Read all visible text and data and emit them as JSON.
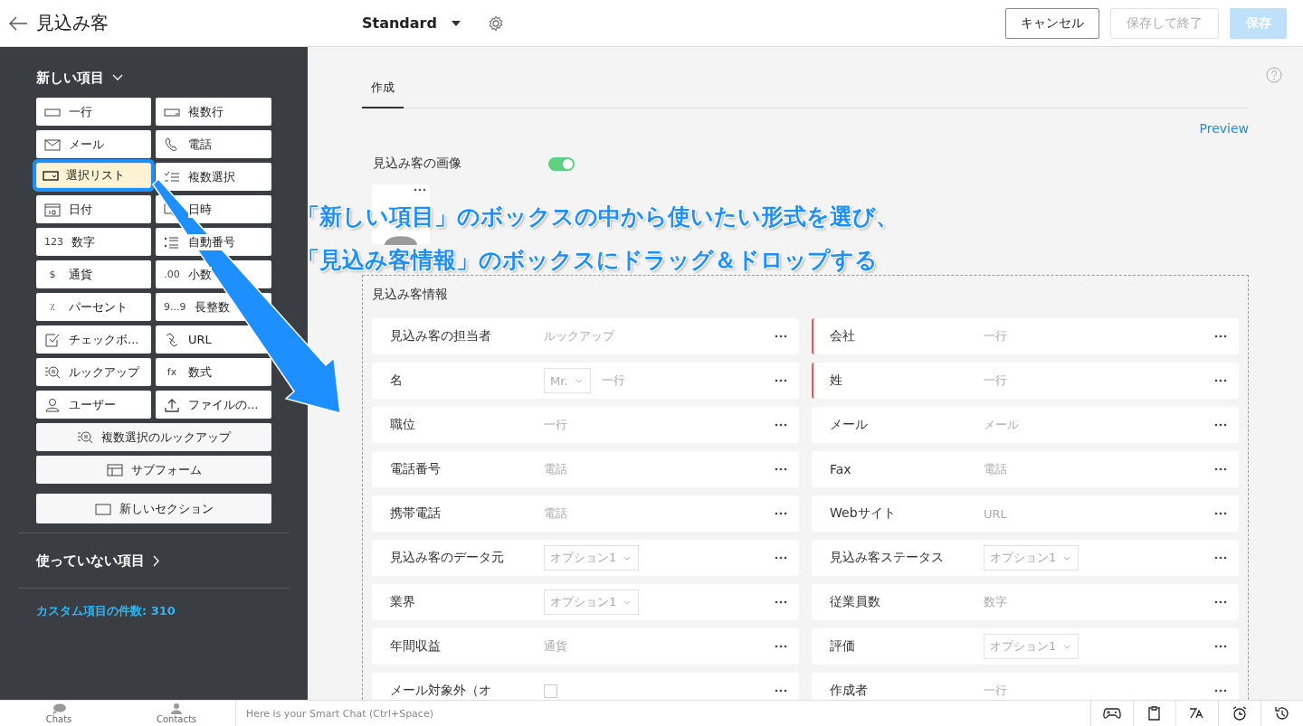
{
  "header": {
    "title": "見込み客",
    "layout_name": "Standard",
    "buttons": [
      {
        "label": "キャンセル",
        "kind": "secondary",
        "disabled": false
      },
      {
        "label": "保存して終了",
        "kind": "secondary",
        "disabled": true
      },
      {
        "label": "保存",
        "kind": "primary",
        "disabled": true
      }
    ]
  },
  "sidebar": {
    "new_fields_title": "新しい項目",
    "field_types": [
      {
        "label": "一行",
        "kind": "half",
        "selected": false
      },
      {
        "label": "複数行",
        "kind": "half",
        "selected": false
      },
      {
        "label": "メール",
        "kind": "half",
        "selected": false
      },
      {
        "label": "電話",
        "kind": "half",
        "selected": false
      },
      {
        "label": "選択リスト",
        "kind": "half",
        "selected": true
      },
      {
        "label": "複数選択",
        "kind": "half",
        "selected": false
      },
      {
        "label": "日付",
        "kind": "half",
        "selected": false
      },
      {
        "label": "日時",
        "kind": "half",
        "selected": false
      },
      {
        "label": "数字",
        "kind": "half",
        "glyph": "123",
        "selected": false
      },
      {
        "label": "自動番号",
        "kind": "half",
        "selected": false
      },
      {
        "label": "通貨",
        "kind": "half",
        "glyph": "$",
        "selected": false
      },
      {
        "label": "小数",
        "kind": "half",
        "glyph": ".00",
        "selected": false
      },
      {
        "label": "パーセント",
        "kind": "half",
        "glyph": "٪",
        "selected": false
      },
      {
        "label": "長整数",
        "kind": "half",
        "glyph": "9...9",
        "selected": false
      },
      {
        "label": "チェックボ...",
        "kind": "half",
        "selected": false
      },
      {
        "label": "URL",
        "kind": "half",
        "selected": false
      },
      {
        "label": "ルックアップ",
        "kind": "half",
        "selected": false
      },
      {
        "label": "数式",
        "kind": "half",
        "glyph": "fx",
        "selected": false
      },
      {
        "label": "ユーザー",
        "kind": "half",
        "selected": false
      },
      {
        "label": "ファイルの...",
        "kind": "half",
        "selected": false
      },
      {
        "label": "複数選択のルックアップ",
        "kind": "wide",
        "selected": false
      },
      {
        "label": "サブフォーム",
        "kind": "wide",
        "selected": false
      },
      {
        "label": "新しいセクション",
        "kind": "section",
        "selected": false
      }
    ],
    "unused_title": "使っていない項目",
    "custom_count": "カスタム項目の件数: 310"
  },
  "main": {
    "tabs": [
      {
        "label": "作成",
        "selected": true
      }
    ],
    "preview_link": "Preview",
    "image_field": {
      "label": "見込み客の画像",
      "on": true
    },
    "section": {
      "title": "見込み客情報",
      "fields": [
        {
          "label": "見込み客の担当者",
          "kind": "text",
          "placeholder": "ルックアップ",
          "required": false
        },
        {
          "label": "会社",
          "kind": "text",
          "placeholder": "一行",
          "required": true
        },
        {
          "label": "名",
          "kind": "salutation",
          "select": "Mr.",
          "placeholder": "一行",
          "required": false
        },
        {
          "label": "姓",
          "kind": "text",
          "placeholder": "一行",
          "required": true
        },
        {
          "label": "職位",
          "kind": "text",
          "placeholder": "一行",
          "required": false
        },
        {
          "label": "メール",
          "kind": "text",
          "placeholder": "メール",
          "required": false
        },
        {
          "label": "電話番号",
          "kind": "text",
          "placeholder": "電話",
          "required": false
        },
        {
          "label": "Fax",
          "kind": "text",
          "placeholder": "電話",
          "required": false
        },
        {
          "label": "携帯電話",
          "kind": "text",
          "placeholder": "電話",
          "required": false
        },
        {
          "label": "Webサイト",
          "kind": "text",
          "placeholder": "URL",
          "required": false
        },
        {
          "label": "見込み客のデータ元",
          "kind": "select",
          "select": "オプション1",
          "required": false
        },
        {
          "label": "見込み客ステータス",
          "kind": "select",
          "select": "オプション1",
          "required": false
        },
        {
          "label": "業界",
          "kind": "select",
          "select": "オプション1",
          "required": false
        },
        {
          "label": "従業員数",
          "kind": "text",
          "placeholder": "数字",
          "required": false
        },
        {
          "label": "年間収益",
          "kind": "text",
          "placeholder": "通貨",
          "required": false
        },
        {
          "label": "評価",
          "kind": "select",
          "select": "オプション1",
          "required": false
        },
        {
          "label": "メール対象外（オ",
          "kind": "checkbox",
          "required": false
        },
        {
          "label": "作成者",
          "kind": "text",
          "placeholder": "一行",
          "required": false
        }
      ]
    }
  },
  "annotation": {
    "lines": [
      "「新しい項目」のボックスの中から使いたい形式を選び、",
      "「見込み客情報」のボックスにドラッグ＆ドロップする"
    ]
  },
  "chat_bar": {
    "tabs": [
      {
        "label": "Chats"
      },
      {
        "label": "Contacts"
      }
    ],
    "placeholder": "Here is your Smart Chat (Ctrl+Space)"
  }
}
